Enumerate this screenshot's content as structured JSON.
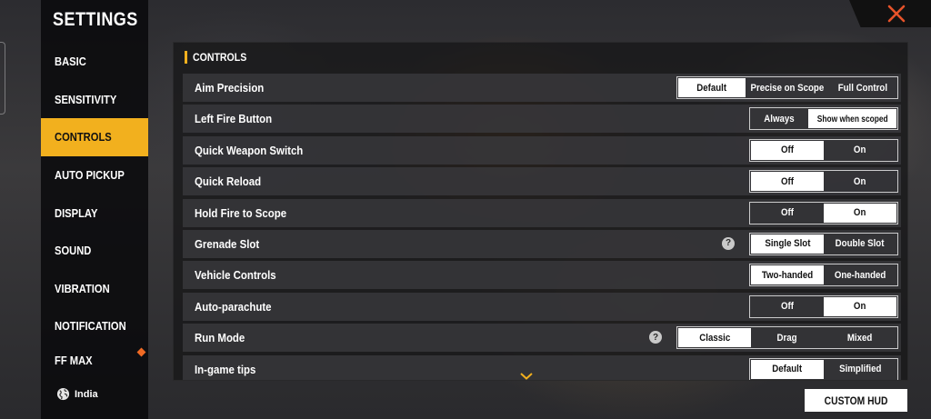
{
  "sidebar": {
    "title": "SETTINGS",
    "items": [
      {
        "label": "BASIC",
        "active": false
      },
      {
        "label": "SENSITIVITY",
        "active": false
      },
      {
        "label": "CONTROLS",
        "active": true
      },
      {
        "label": "AUTO PICKUP",
        "active": false
      },
      {
        "label": "DISPLAY",
        "active": false
      },
      {
        "label": "SOUND",
        "active": false
      },
      {
        "label": "VIBRATION",
        "active": false
      },
      {
        "label": "NOTIFICATION",
        "active": false
      },
      {
        "label": "FF MAX",
        "active": false
      }
    ],
    "region": "India",
    "notification_dot_color": "#f06a24"
  },
  "section": {
    "title": "CONTROLS",
    "accent_color": "#f2b01e"
  },
  "rows": [
    {
      "label": "Aim Precision",
      "options": [
        "Default",
        "Precise on Scope",
        "Full Control"
      ],
      "selected": 0
    },
    {
      "label": "Left Fire Button",
      "options": [
        "Always",
        "Show when scoped"
      ],
      "selected": 1
    },
    {
      "label": "Quick Weapon Switch",
      "options": [
        "Off",
        "On"
      ],
      "selected": 0
    },
    {
      "label": "Quick Reload",
      "options": [
        "Off",
        "On"
      ],
      "selected": 0
    },
    {
      "label": "Hold Fire to Scope",
      "options": [
        "Off",
        "On"
      ],
      "selected": 1
    },
    {
      "label": "Grenade Slot",
      "options": [
        "Single Slot",
        "Double Slot"
      ],
      "selected": 0,
      "help": "?"
    },
    {
      "label": "Vehicle Controls",
      "options": [
        "Two-handed",
        "One-handed"
      ],
      "selected": 0
    },
    {
      "label": "Auto-parachute",
      "options": [
        "Off",
        "On"
      ],
      "selected": 1
    },
    {
      "label": "Run Mode",
      "options": [
        "Classic",
        "Drag",
        "Mixed"
      ],
      "selected": 0,
      "help": "?"
    },
    {
      "label": "In-game tips",
      "options": [
        "Default",
        "Simplified"
      ],
      "selected": 0
    }
  ],
  "buttons": {
    "custom_hud": "CUSTOM HUD"
  },
  "colors": {
    "accent": "#f2b01e",
    "close": "#e8532a"
  }
}
